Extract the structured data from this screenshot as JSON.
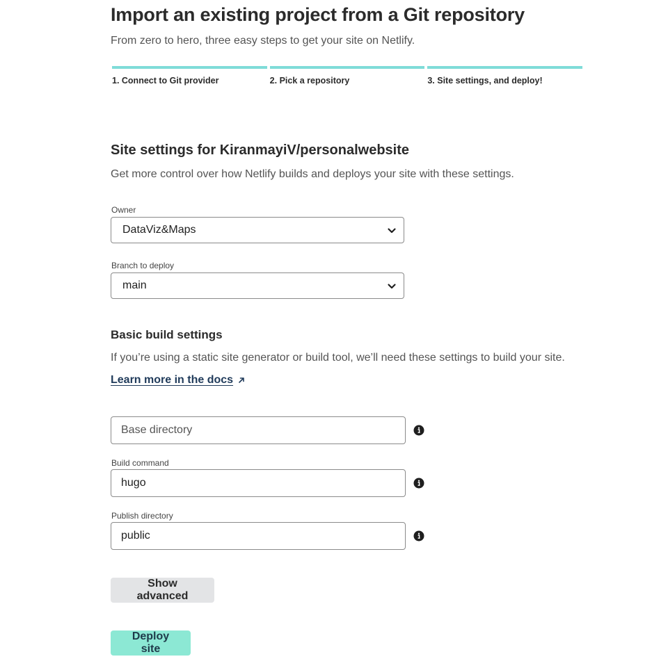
{
  "header": {
    "title": "Import an existing project from a Git repository",
    "subtitle": "From zero to hero, three easy steps to get your site on Netlify."
  },
  "steps": [
    {
      "label": "1. Connect to Git provider"
    },
    {
      "label": "2. Pick a repository"
    },
    {
      "label": "3. Site settings, and deploy!"
    }
  ],
  "site_settings": {
    "title": "Site settings for KiranmayiV/personalwebsite",
    "description": "Get more control over how Netlify builds and deploys your site with these settings.",
    "owner": {
      "label": "Owner",
      "value": "DataViz&Maps"
    },
    "branch": {
      "label": "Branch to deploy",
      "value": "main"
    }
  },
  "build_settings": {
    "title": "Basic build settings",
    "description": "If you’re using a static site generator or build tool, we’ll need these settings to build your site.",
    "docs_link": "Learn more in the docs",
    "base_directory": {
      "placeholder": "Base directory",
      "value": ""
    },
    "build_command": {
      "label": "Build command",
      "value": "hugo"
    },
    "publish_directory": {
      "label": "Publish directory",
      "value": "public"
    }
  },
  "actions": {
    "show_advanced": "Show advanced",
    "deploy": "Deploy site"
  },
  "icons": {
    "select": "chevron-down-icon",
    "info": "info-icon",
    "external_link": "external-link-arrow-icon"
  },
  "colors": {
    "step_bar": "#7fdcd8",
    "primary_button": "#8ce8d4",
    "secondary_button": "#e3e4e6",
    "link": "#1f3a5a"
  }
}
